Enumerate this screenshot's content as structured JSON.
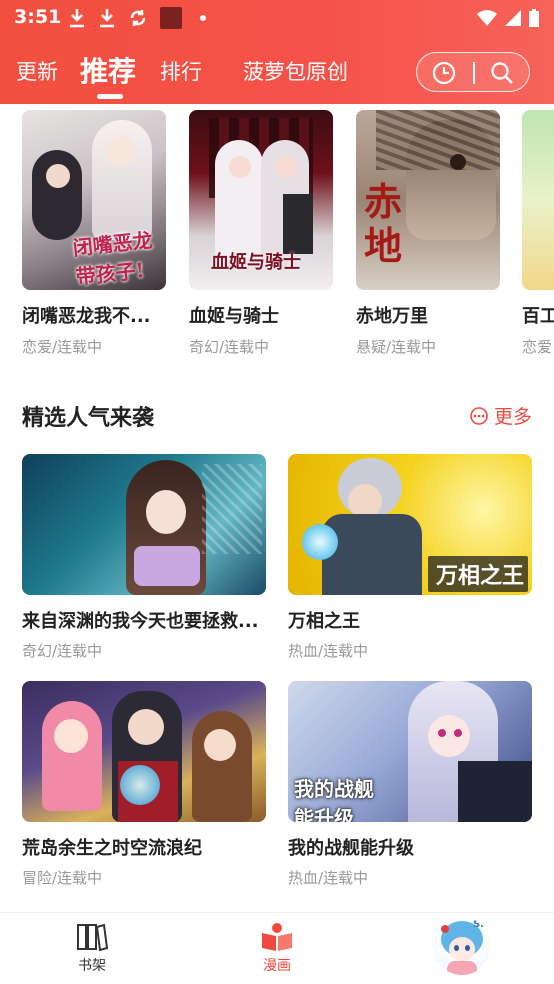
{
  "status_bar": {
    "time": "3:51"
  },
  "tabs": [
    {
      "label": "更新"
    },
    {
      "label": "推荐"
    },
    {
      "label": "排行"
    },
    {
      "label": "菠萝包原创"
    }
  ],
  "header_actions": {
    "history_icon": "clock-icon",
    "search_icon": "search-icon"
  },
  "carousel": [
    {
      "title": "闭嘴恶龙我不...",
      "genre": "恋爱/连载中"
    },
    {
      "title": "血姬与骑士",
      "genre": "奇幻/连载中"
    },
    {
      "title": "赤地万里",
      "genre": "悬疑/连载中"
    },
    {
      "title": "百工",
      "genre": "恋爱"
    }
  ],
  "section": {
    "title": "精选人气来袭",
    "more_label": "更多",
    "items": [
      {
        "title": "来自深渊的我今天也要拯救...",
        "genre": "奇幻/连载中"
      },
      {
        "title": "万相之王",
        "genre": "热血/连载中"
      },
      {
        "title": "荒岛余生之时空流浪纪",
        "genre": "冒险/连载中"
      },
      {
        "title": "我的战舰能升级",
        "genre": "热血/连载中"
      }
    ]
  },
  "bottom_nav": [
    {
      "label": "书架",
      "icon": "bookshelf-icon"
    },
    {
      "label": "漫画",
      "icon": "comic-book-icon"
    },
    {
      "label": "",
      "icon": "profile-avatar"
    }
  ],
  "colors": {
    "accent": "#f04a3e",
    "header": "#f5534a"
  }
}
